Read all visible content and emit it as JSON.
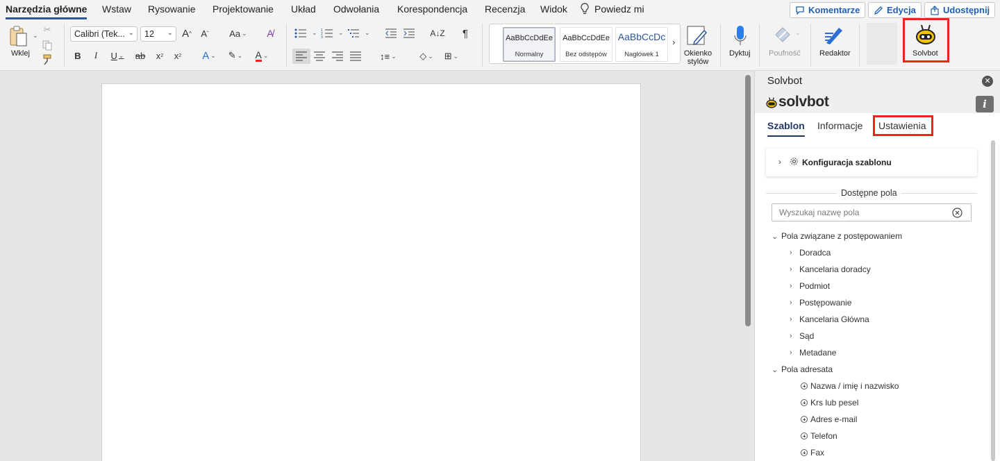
{
  "tabs": [
    "Narzędzia główne",
    "Wstaw",
    "Rysowanie",
    "Projektowanie",
    "Układ",
    "Odwołania",
    "Korespondencja",
    "Recenzja",
    "Widok"
  ],
  "tell_me": "Powiedz mi",
  "top_buttons": {
    "comments": "Komentarze",
    "edit": "Edycja",
    "share": "Udostępnij"
  },
  "ribbon": {
    "paste_label": "Wklej",
    "font_name": "Calibri (Tek...",
    "font_size": "12",
    "styles": [
      {
        "sample": "AaBbCcDdEe",
        "name": "Normalny"
      },
      {
        "sample": "AaBbCcDdEe",
        "name": "Bez odstępów"
      },
      {
        "sample": "AaBbCcDc",
        "name": "Nagłówek 1"
      }
    ],
    "styles_pane_label_1": "Okienko",
    "styles_pane_label_2": "stylów",
    "dictate_label": "Dyktuj",
    "sensitivity_label": "Poufność",
    "editor_label": "Redaktor",
    "solvbot_label": "Solvbot"
  },
  "panel": {
    "title": "Solvbot",
    "brand": "solvbot",
    "tabs": [
      "Szablon",
      "Informacje",
      "Ustawienia"
    ],
    "config_label": "Konfiguracja szablonu",
    "available_fields": "Dostępne pola",
    "search_placeholder": "Wyszukaj nazwę pola",
    "group1": "Pola związane z postępowaniem",
    "group1_items": [
      "Doradca",
      "Kancelaria doradcy",
      "Podmiot",
      "Postępowanie",
      "Kancelaria Główna",
      "Sąd",
      "Metadane"
    ],
    "group2": "Pola adresata",
    "group2_items": [
      "Nazwa / imię i nazwisko",
      "Krs lub pesel",
      "Adres e-mail",
      "Telefon",
      "Fax"
    ]
  },
  "colors": {
    "accent": "#2b5797",
    "highlight": "#e8261c",
    "brand_yellow": "#f5c400"
  }
}
